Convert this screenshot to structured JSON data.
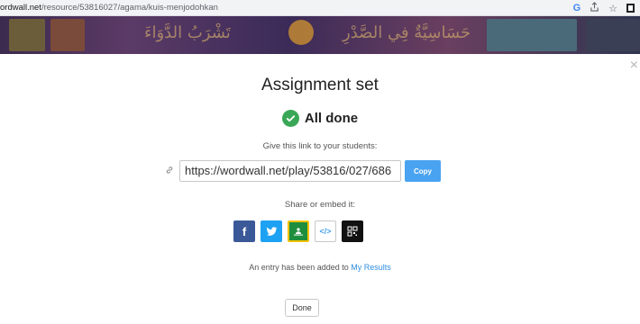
{
  "browser": {
    "url_domain": "ordwall.net",
    "url_path": "/resource/53816027/agama/kuis-menjodohkan"
  },
  "banner": {
    "arabic_1": "تَشْرَبُ الدَّوَاءَ",
    "arabic_2": "حَسَاسِيَّةٌ فِي الصَّدْرِ"
  },
  "modal": {
    "title": "Assignment set",
    "status": "All done",
    "give_link_text": "Give this link to your students:",
    "link_value": "https://wordwall.net/play/53816/027/686",
    "copy_label": "Copy",
    "share_text": "Share or embed it:",
    "entry_text": "An entry has been added to ",
    "entry_link": "My Results",
    "done_label": "Done",
    "close": "×"
  },
  "share_buttons": {
    "facebook": "f",
    "embed": "</>"
  },
  "colors": {
    "accent_blue": "#4aa3f0",
    "success_green": "#3aa757",
    "facebook": "#3b5998",
    "twitter": "#1da1f2",
    "classroom": "#1e8e3e"
  },
  "icons": [
    "google-icon",
    "share-icon",
    "star-icon",
    "extension-icon",
    "close-icon",
    "check-icon",
    "link-icon",
    "facebook-icon",
    "twitter-icon",
    "google-classroom-icon",
    "embed-icon",
    "qr-code-icon"
  ]
}
